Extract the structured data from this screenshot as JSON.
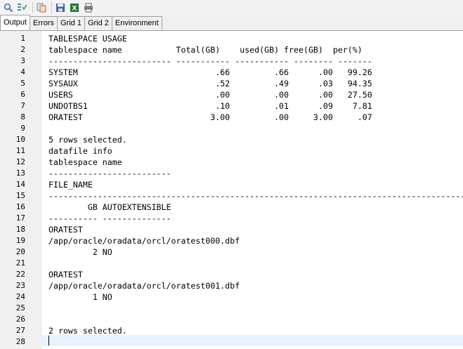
{
  "toolbar": {
    "icons": [
      "search-icon",
      "filter-icon",
      "copy-icon",
      "save-icon",
      "excel-icon",
      "print-icon"
    ]
  },
  "tabs": [
    {
      "label": "Output",
      "active": true
    },
    {
      "label": "Errors",
      "active": false
    },
    {
      "label": "Grid 1",
      "active": false
    },
    {
      "label": "Grid 2",
      "active": false
    },
    {
      "label": "Environment",
      "active": false
    }
  ],
  "editor": {
    "lines": [
      {
        "num": "1",
        "text": "TABLESPACE USAGE"
      },
      {
        "num": "2",
        "text": "tablespace name           Total(GB)    used(GB) free(GB)  per(%)"
      },
      {
        "num": "3",
        "text": "------------------------- ----------- ----------- -------- -------"
      },
      {
        "num": "4",
        "text": "SYSTEM                            .66         .66      .00   99.26"
      },
      {
        "num": "5",
        "text": "SYSAUX                            .52         .49      .03   94.35"
      },
      {
        "num": "6",
        "text": "USERS                             .00         .00      .00   27.50"
      },
      {
        "num": "7",
        "text": "UNDOTBS1                          .10         .01      .09    7.81"
      },
      {
        "num": "8",
        "text": "ORATEST                          3.00         .00     3.00     .07"
      },
      {
        "num": "9",
        "text": ""
      },
      {
        "num": "10",
        "text": "5 rows selected."
      },
      {
        "num": "11",
        "text": "datafile info"
      },
      {
        "num": "12",
        "text": "tablespace name"
      },
      {
        "num": "13",
        "text": "-------------------------"
      },
      {
        "num": "14",
        "text": "FILE_NAME"
      },
      {
        "num": "15",
        "text": "-----------------------------------------------------------------------------------------------------"
      },
      {
        "num": "16",
        "text": "        GB AUTOEXTENSIBLE"
      },
      {
        "num": "17",
        "text": "---------- --------------"
      },
      {
        "num": "18",
        "text": "ORATEST"
      },
      {
        "num": "19",
        "text": "/app/oracle/oradata/orcl/oratest000.dbf"
      },
      {
        "num": "20",
        "text": "         2 NO"
      },
      {
        "num": "21",
        "text": ""
      },
      {
        "num": "22",
        "text": "ORATEST"
      },
      {
        "num": "23",
        "text": "/app/oracle/oradata/orcl/oratest001.dbf"
      },
      {
        "num": "24",
        "text": "         1 NO"
      },
      {
        "num": "25",
        "text": ""
      },
      {
        "num": "26",
        "text": ""
      },
      {
        "num": "27",
        "text": "2 rows selected."
      },
      {
        "num": "28",
        "text": ""
      }
    ]
  }
}
